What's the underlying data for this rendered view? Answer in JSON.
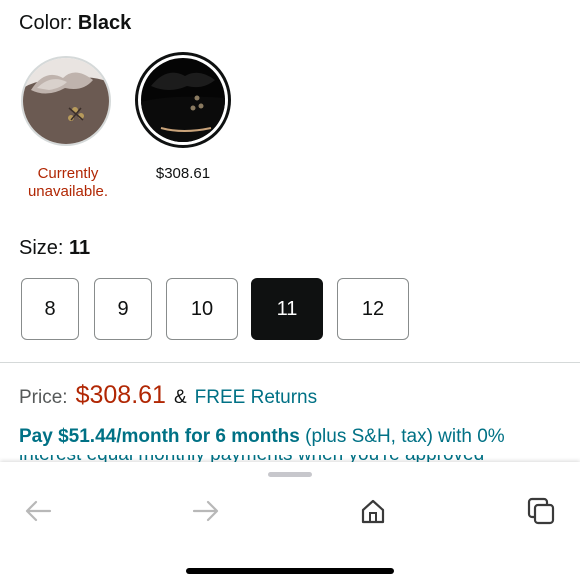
{
  "color_selector": {
    "label": "Color:",
    "selected": "Black",
    "options": [
      {
        "name": "brown",
        "status": "Currently unavailable.",
        "status_line1": "Currently",
        "status_line2": "unavailable."
      },
      {
        "name": "black",
        "price": "$308.61",
        "selected": true
      }
    ]
  },
  "size_selector": {
    "label": "Size:",
    "selected": "11",
    "options": [
      "8",
      "9",
      "10",
      "11",
      "12"
    ]
  },
  "pricing": {
    "label": "Price:",
    "price": "$308.61",
    "ampersand": "&",
    "returns": "FREE Returns",
    "installment_bold": "Pay $51.44/month for 6 months",
    "installment_rest": " (plus S&H, tax) with 0%",
    "installment_cut": "interest equal monthly payments when you're approved"
  },
  "browser_toolbar": {
    "icons": [
      "back-arrow-icon",
      "forward-arrow-icon",
      "home-icon",
      "tabs-icon"
    ]
  },
  "colors": {
    "price_red": "#b12704",
    "link_teal": "#007185",
    "selected_dark": "#0f1111"
  }
}
